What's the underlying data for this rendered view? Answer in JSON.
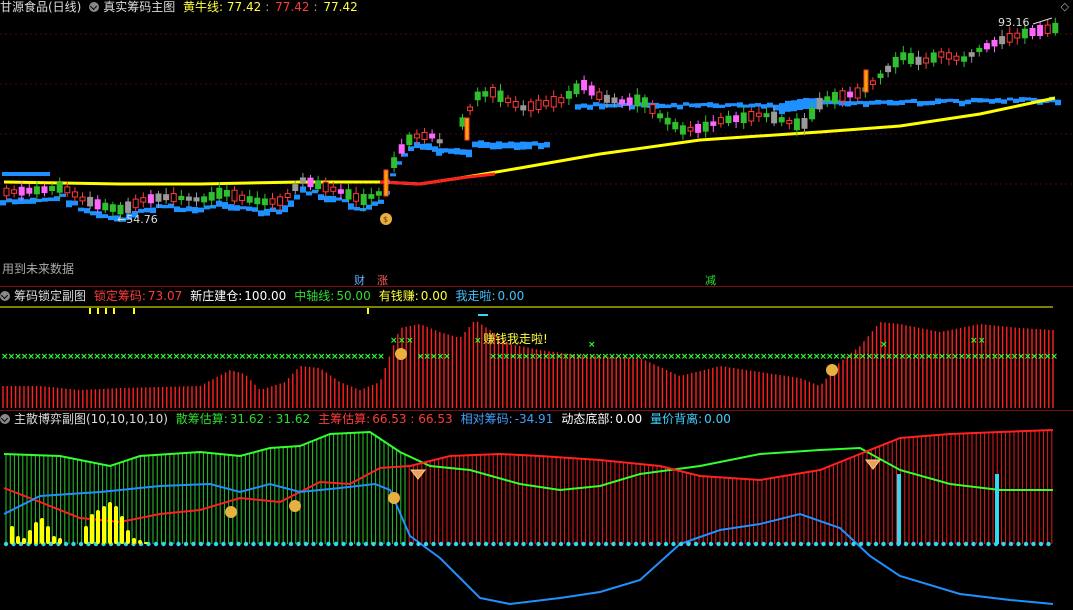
{
  "main": {
    "stock_name": "甘源食品(日线)",
    "indicator_name": "真实筹码主图",
    "huangniu_label": "黄牛线:",
    "huangniu_values": [
      "77.42",
      "77.42",
      "77.42"
    ],
    "high_label": "93.16",
    "low_label": "54.76",
    "future_data_label": "用到未来数据",
    "event_markers": [
      "财",
      "涨",
      "减"
    ],
    "diamond_icon": "◇"
  },
  "panel1": {
    "name": "筹码锁定副图",
    "fields": [
      {
        "label": "锁定筹码:",
        "value": "73.07",
        "color": "#ff3b3b"
      },
      {
        "label": "新庄建仓:",
        "value": "100.00",
        "color": "#ffffff"
      },
      {
        "label": "中轴线:",
        "value": "50.00",
        "color": "#2fdc2f"
      },
      {
        "label": "有钱赚:",
        "value": "0.00",
        "color": "#ffff40"
      },
      {
        "label": "我走啦:",
        "value": "0.00",
        "color": "#40c0ff"
      }
    ],
    "annotation": "赚钱我走啦!"
  },
  "panel2": {
    "name": "主散博弈副图(10,10,10,10)",
    "fields": [
      {
        "label": "散筹估算:",
        "value": "31.62 : 31.62",
        "color": "#2fdc2f"
      },
      {
        "label": "主筹估算:",
        "value": "66.53 : 66.53",
        "color": "#ff3b3b"
      },
      {
        "label": "相对筹码:",
        "value": "-34.91",
        "color": "#40a0ff"
      },
      {
        "label": "动态底部:",
        "value": "0.00",
        "color": "#ffffff"
      },
      {
        "label": "量价背离:",
        "value": "0.00",
        "color": "#40d0ff"
      }
    ]
  },
  "colors": {
    "up": "#ff3b3b",
    "down": "#2fbf2f",
    "yellow": "#ffff00",
    "blue": "#1e90ff",
    "magenta": "#ff66ff",
    "gray": "#9a9a9a",
    "cyan": "#30d8f0",
    "green": "#2fdc2f"
  }
}
